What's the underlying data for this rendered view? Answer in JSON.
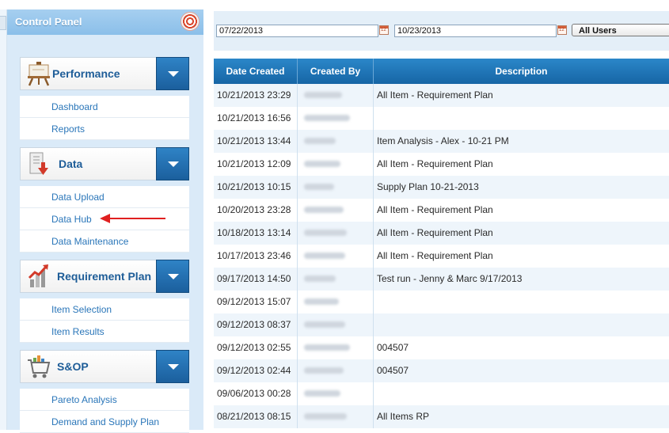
{
  "sidebar": {
    "title": "Control Panel",
    "sections": [
      {
        "title": "Performance",
        "icon": "easel-icon",
        "items": [
          "Dashboard",
          "Reports"
        ]
      },
      {
        "title": "Data",
        "icon": "data-download-icon",
        "items": [
          "Data Upload",
          "Data Hub",
          "Data Maintenance"
        ]
      },
      {
        "title": "Requirement Plan",
        "icon": "bar-chart-arrow-icon",
        "items": [
          "Item Selection",
          "Item Results"
        ]
      },
      {
        "title": "S&OP",
        "icon": "shopping-cart-icon",
        "items": [
          "Pareto Analysis",
          "Demand and Supply Plan"
        ]
      }
    ]
  },
  "filters": {
    "start_date": "07/22/2013",
    "end_date": "10/23/2013",
    "user_select": "All Users"
  },
  "table": {
    "headers": [
      "Date Created",
      "Created By",
      "Description"
    ],
    "rows": [
      {
        "date": "10/21/2013 23:29",
        "desc": "All Item - Requirement Plan"
      },
      {
        "date": "10/21/2013 16:56",
        "desc": ""
      },
      {
        "date": "10/21/2013 13:44",
        "desc": "Item Analysis - Alex - 10-21 PM"
      },
      {
        "date": "10/21/2013 12:09",
        "desc": "All Item - Requirement Plan"
      },
      {
        "date": "10/21/2013 10:15",
        "desc": "Supply Plan 10-21-2013"
      },
      {
        "date": "10/20/2013 23:28",
        "desc": "All Item - Requirement Plan"
      },
      {
        "date": "10/18/2013 13:14",
        "desc": "All Item - Requirement Plan"
      },
      {
        "date": "10/17/2013 23:46",
        "desc": "All Item - Requirement Plan"
      },
      {
        "date": "09/17/2013 14:50",
        "desc": "Test run - Jenny & Marc 9/17/2013"
      },
      {
        "date": "09/12/2013 15:07",
        "desc": ""
      },
      {
        "date": "09/12/2013 08:37",
        "desc": ""
      },
      {
        "date": "09/12/2013 02:55",
        "desc": "004507"
      },
      {
        "date": "09/12/2013 02:44",
        "desc": "004507"
      },
      {
        "date": "09/06/2013 00:28",
        "desc": ""
      },
      {
        "date": "08/21/2013 08:15",
        "desc": "All Items RP"
      }
    ]
  }
}
